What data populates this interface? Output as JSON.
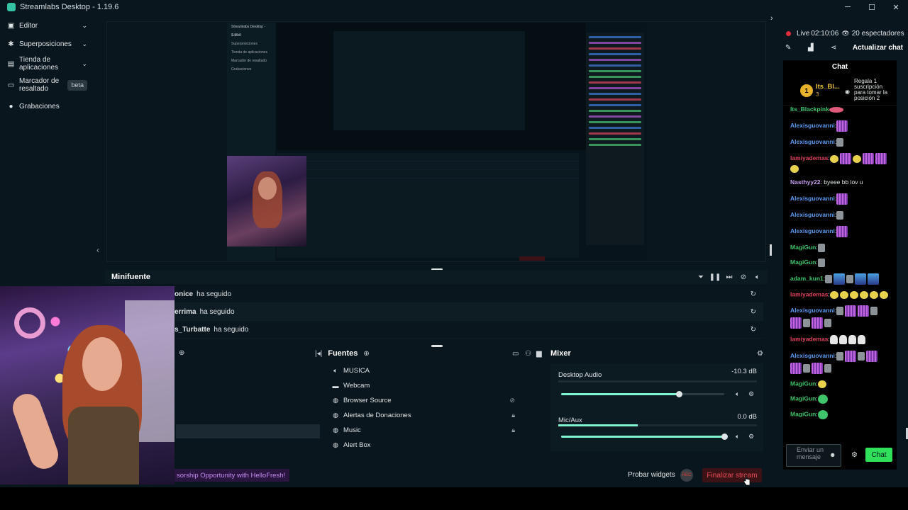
{
  "window": {
    "title": "Streamlabs Desktop - 1.19.6",
    "controls": [
      "─",
      "☐",
      "✕"
    ]
  },
  "sidebar": {
    "items": [
      {
        "label": "Editor",
        "icon": "editor-icon"
      },
      {
        "label": "Superposiciones",
        "icon": "themes-icon"
      },
      {
        "label_line1": "Tienda de",
        "label_line2": "aplicaciones",
        "icon": "store-icon"
      },
      {
        "label_line1": "Marcador de",
        "label_line2": "resaltado",
        "icon": "highlighter-icon",
        "badge": "beta"
      },
      {
        "label": "Grabaciones",
        "icon": "recordings-icon"
      }
    ]
  },
  "preview": {
    "mini_title": "Streamlabs Desktop - 1.19.6",
    "mini_sidebar": [
      "Editor",
      "Superposiciones",
      "Tienda de aplicaciones",
      "Marcador de resaltado",
      "Grabaciones"
    ]
  },
  "minifuente": {
    "title": "Minifuente",
    "events": [
      {
        "name": "onice",
        "action": "ha seguido"
      },
      {
        "name": "errima",
        "action": "ha seguido"
      },
      {
        "name": "s_Turbatte",
        "action": "ha seguido"
      }
    ]
  },
  "sources": {
    "title": "Fuentes",
    "items": [
      {
        "label": "MUSICA",
        "icon": "speaker-icon"
      },
      {
        "label": "Webcam",
        "icon": "folder-icon"
      },
      {
        "label": "Browser Source",
        "icon": "globe-icon",
        "right_icon": "hidden-eye-icon"
      },
      {
        "label": "Alertas de Donaciones",
        "icon": "globe-icon",
        "right_icon": "lock-icon"
      },
      {
        "label": "Music",
        "icon": "globe-icon",
        "right_icon": "lock-icon"
      },
      {
        "label": "Alert Box",
        "icon": "globe-icon"
      }
    ]
  },
  "mixer": {
    "title": "Mixer",
    "channels": [
      {
        "name": "Desktop Audio",
        "db": "-10.3 dB",
        "volume": 0.72
      },
      {
        "name": "Mic/Aux",
        "db": "0.0 dB",
        "volume": 1.0
      }
    ]
  },
  "footer": {
    "promo": "sorship Opportunity with HelloFresh!",
    "test_widgets": "Probar widgets",
    "rec_label": "REC",
    "end_stream": "Finalizar stream"
  },
  "chat": {
    "live_label": "Live",
    "live_time": "02:10:06",
    "viewers": "20 espectadores",
    "refresh_label": "Actualizar chat",
    "title": "Chat",
    "pinned": {
      "rank": "1",
      "name": "Its_Bl...",
      "count": "3",
      "text": "Regala 1 suscripción para tomar la posición 2"
    },
    "messages": [
      {
        "user": "Its_Blackpink",
        "color": "#3ec46a",
        "text": "",
        "emotes": [
          "rose"
        ]
      },
      {
        "user": "Alexisguovanni",
        "color": "#5b9bf0",
        "text": ":",
        "emotes": [
          "grid"
        ]
      },
      {
        "user": "Alexisguovanni",
        "color": "#5b9bf0",
        "text": ":",
        "emotes": [
          "gray"
        ]
      },
      {
        "user": "lamiyademas",
        "color": "#e0445e",
        "text": ":",
        "emotes": [
          "blob",
          "grid",
          "blob",
          "grid",
          "grid",
          "blob"
        ]
      },
      {
        "user": "Nasthyy22",
        "color": "#c79ff0",
        "text": ": byeee bb lov u",
        "emotes": []
      },
      {
        "user": "Alexisguovanni",
        "color": "#5b9bf0",
        "text": ":",
        "emotes": [
          "grid"
        ]
      },
      {
        "user": "Alexisguovanni",
        "color": "#5b9bf0",
        "text": ":",
        "emotes": [
          "gray"
        ]
      },
      {
        "user": "Alexisguovanni",
        "color": "#5b9bf0",
        "text": ":",
        "emotes": [
          "grid"
        ]
      },
      {
        "user": "MagiGun",
        "color": "#3ec46a",
        "text": ":",
        "emotes": [
          "gray"
        ]
      },
      {
        "user": "MagiGun",
        "color": "#3ec46a",
        "text": ":",
        "emotes": [
          "gray"
        ]
      },
      {
        "user": "adam_kun1",
        "color": "#3ec46a",
        "text": ":",
        "emotes": [
          "gray",
          "pc",
          "gray",
          "pc",
          "pc"
        ]
      },
      {
        "user": "lamiyademas",
        "color": "#e0445e",
        "text": ":",
        "emotes": [
          "blob",
          "blob",
          "blob",
          "blob",
          "blob",
          "blob"
        ]
      },
      {
        "user": "Alexisguovanni",
        "color": "#5b9bf0",
        "text": ":",
        "emotes": [
          "gray",
          "grid",
          "grid",
          "gray",
          "grid",
          "gray",
          "grid",
          "gray"
        ]
      },
      {
        "user": "lamiyademas",
        "color": "#e0445e",
        "text": ":",
        "emotes": [
          "duck",
          "duck",
          "duck",
          "duck"
        ]
      },
      {
        "user": "Alexisguovanni",
        "color": "#5b9bf0",
        "text": ":",
        "emotes": [
          "gray",
          "grid",
          "gray",
          "grid",
          "grid",
          "gray",
          "grid",
          "gray"
        ]
      },
      {
        "user": "MagiGun",
        "color": "#3ec46a",
        "text": ":",
        "emotes": [
          "blob"
        ]
      },
      {
        "user": "MagiGun",
        "color": "#3ec46a",
        "text": ":",
        "emotes": [
          "green"
        ]
      },
      {
        "user": "MagiGun",
        "color": "#3ec46a",
        "text": ":",
        "emotes": [
          "green"
        ]
      }
    ],
    "input_placeholder": "Enviar un mensaje",
    "send_label": "Chat"
  },
  "colors": {
    "accent": "#31c3a2",
    "meter": "#80f5d2",
    "live": "#e02d3a",
    "send": "#2fe05a",
    "end_stream": "#f04e5a"
  }
}
